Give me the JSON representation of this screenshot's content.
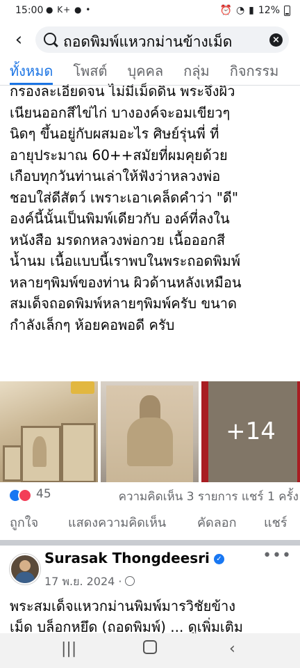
{
  "status": {
    "time": "15:00",
    "apps": "● K+ ● •",
    "battery": "12%",
    "icons": [
      "alarm-icon",
      "wifi-icon",
      "signal-icon",
      "battery-icon"
    ]
  },
  "search": {
    "query": "ถอดพิมพ์แหวกม่านข้างเม็ด"
  },
  "tabs": [
    "ทั้งหมด",
    "โพสต์",
    "บุคคล",
    "กลุ่ม",
    "กิจกรรม"
  ],
  "post1": {
    "lines": [
      "กรองละเอียดจน ไม่มีเม็ดดิน พระจึงผิว",
      "เนียนออกสีไข่ไก่ บางองค์จะอมเขียวๆ",
      "นิดๆ ขึ้นอยู่กับผสมอะไร ศิษย์รุ่นพี่ ที่",
      "อายุประมาณ 60++สมัยที่ผมคุยด้วย",
      "เกือบทุกวันท่านเล่าให้ฟังว่าหลวงพ่อ",
      "ชอบใส่ดีสัตว์ เพราะเอาเคล็ดคำว่า \"ดี\"",
      "องค์นี้นั้นเป็นพิมพ์เดียวกับ องค์ที่ลงใน",
      "หนังสือ มรดกหลวงพ่อกวย เนื้อออกสี",
      "น้ำนม เนื้อแบบนี้เราพบในพระถอดพิมพ์",
      "หลายๆพิมพ์ของท่าน ผิวด้านหลังเหมือน",
      "สมเด็จถอดพิมพ์หลายๆพิมพ์ครับ ขนาด",
      "กำลังเล็กๆ ห้อยคอพอดี ครับ"
    ],
    "more_photos": "+14",
    "reaction_count": "45",
    "stats": "ความคิดเห็น 3 รายการ  แชร์ 1 ครั้ง",
    "actions": [
      "ถูกใจ",
      "แสดงความคิดเห็น",
      "คัดลอก",
      "แชร์"
    ]
  },
  "post2": {
    "author": "Surasak Thongdeesri",
    "date": "17 พ.ย. 2024 ·",
    "text": [
      "พระสมเด็จแหวกม่านพิมพ์มารวิชัยข้าง",
      "เม็ด บล็อกหยึด (ถอดพิมพ์) ... ดูเพิ่มเติม"
    ]
  },
  "colors": {
    "accent": "#1b74e4",
    "secondary_text": "#65676b",
    "like": "#1877f2",
    "love": "#f33e58"
  }
}
